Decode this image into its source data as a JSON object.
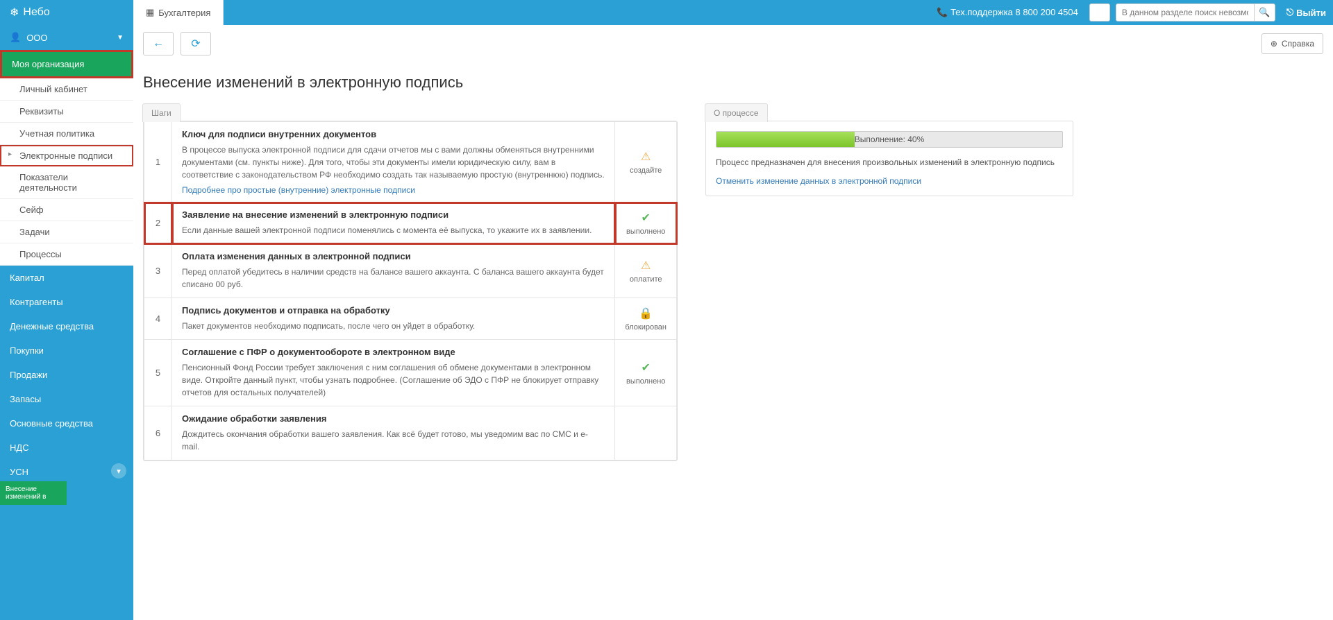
{
  "brand": "Небо",
  "top_tab": "Бухгалтерия",
  "support": "Тех.поддержка 8 800 200 4504",
  "search_placeholder": "В данном разделе поиск невозможен",
  "logout": "Выйти",
  "help_btn": "Справка",
  "org_name": "ООО",
  "page_title": "Внесение изменений в электронную подпись",
  "sidebar": {
    "active_section": "Моя организация",
    "sub_items": [
      "Личный кабинет",
      "Реквизиты",
      "Учетная политика",
      "Электронные подписи",
      "Показатели деятельности",
      "Сейф",
      "Задачи",
      "Процессы"
    ],
    "items": [
      "Капитал",
      "Контрагенты",
      "Денежные средства",
      "Покупки",
      "Продажи",
      "Запасы",
      "Основные средства",
      "НДС",
      "УСН"
    ],
    "bottom_tab": "Внесение изменений в"
  },
  "steps_tab": "Шаги",
  "process_tab": "О процессе",
  "steps": [
    {
      "num": "1",
      "title": "Ключ для подписи внутренних документов",
      "desc": "В процессе выпуска электронной подписи для сдачи отчетов мы с вами должны обменяться внутренними документами (см. пункты ниже). Для того, чтобы эти документы имели юридическую силу, вам в соответствие с законодательством РФ необходимо создать так называемую простую (внутреннюю) подпись.",
      "link": "Подробнее про простые (внутренние) электронные подписи",
      "status_icon": "warn",
      "status_label": "создайте"
    },
    {
      "num": "2",
      "title": "Заявление на внесение изменений в электронную подписи",
      "desc": "Если данные вашей электронной подписи поменялись с момента её выпуска, то укажите их в заявлении.",
      "status_icon": "ok",
      "status_label": "выполнено",
      "highlight": true
    },
    {
      "num": "3",
      "title": "Оплата изменения данных в электронной подписи",
      "desc": "Перед оплатой убедитесь в наличии средств на балансе вашего аккаунта. С баланса вашего аккаунта будет списано 00 руб.",
      "status_icon": "warn",
      "status_label": "оплатите"
    },
    {
      "num": "4",
      "title": "Подпись документов и отправка на обработку",
      "desc": "Пакет документов необходимо подписать, после чего он уйдет в обработку.",
      "status_icon": "lock",
      "status_label": "блокирован"
    },
    {
      "num": "5",
      "title": "Соглашение с ПФР о документообороте в электронном виде",
      "desc": "Пенсионный Фонд России требует заключения с ним соглашения об обмене документами в электронном виде. Откройте данный пункт, чтобы узнать подробнее. (Соглашение об ЭДО с ПФР не блокирует отправку отчетов для остальных получателей)",
      "status_icon": "ok",
      "status_label": "выполнено"
    },
    {
      "num": "6",
      "title": "Ожидание обработки заявления",
      "desc": "Дождитесь окончания обработки вашего заявления. Как всё будет готово, мы уведомим вас по СМС и e-mail.",
      "status_icon": "",
      "status_label": ""
    }
  ],
  "process": {
    "progress_label": "Выполнение: 40%",
    "progress_pct": 40,
    "desc": "Процесс предназначен для внесения произвольных изменений в электронную подпись",
    "cancel": "Отменить изменение данных в электронной подписи"
  }
}
